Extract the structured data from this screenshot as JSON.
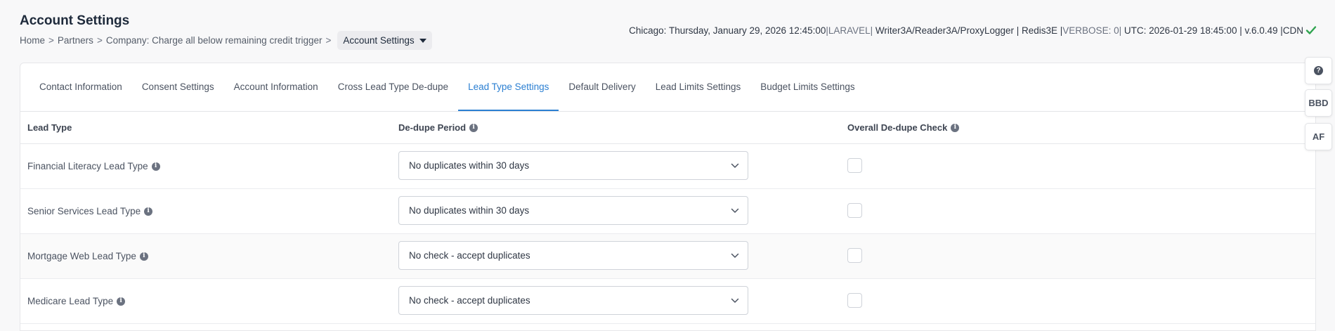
{
  "header": {
    "title": "Account Settings",
    "breadcrumb": [
      {
        "label": "Home"
      },
      {
        "label": "Partners"
      },
      {
        "label": "Company: Charge all below remaining credit trigger"
      }
    ],
    "breadcrumb_separator": ">",
    "current_page": "Account Settings"
  },
  "status": {
    "time": "Chicago: Thursday, January 29, 2026 12:45:00",
    "framework": "|LARAVEL|",
    "loggers": " Writer3A/Reader3A/ProxyLogger | Redis3E |",
    "verbose": "VERBOSE: 0|",
    "utc": " UTC: 2026-01-29 18:45:00 | v.6.0.49 |CDN",
    "cdn_ok_color": "#2fa44f"
  },
  "tabs": [
    {
      "label": "Contact Information",
      "active": false
    },
    {
      "label": "Consent Settings",
      "active": false
    },
    {
      "label": "Account Information",
      "active": false
    },
    {
      "label": "Cross Lead Type De-dupe",
      "active": false
    },
    {
      "label": "Lead Type Settings",
      "active": true
    },
    {
      "label": "Default Delivery",
      "active": false
    },
    {
      "label": "Lead Limits Settings",
      "active": false
    },
    {
      "label": "Budget Limits Settings",
      "active": false
    }
  ],
  "table": {
    "columns": [
      "Lead Type",
      "De-dupe Period",
      "Overall De-dupe Check"
    ],
    "rows": [
      {
        "lead_type": "Financial Literacy Lead Type",
        "dedupe_period": "No duplicates within 30 days",
        "overall_check": false
      },
      {
        "lead_type": "Senior Services Lead Type",
        "dedupe_period": "No duplicates within 30 days",
        "overall_check": false
      },
      {
        "lead_type": "Mortgage Web Lead Type",
        "dedupe_period": "No check - accept duplicates",
        "overall_check": false
      },
      {
        "lead_type": "Medicare Lead Type",
        "dedupe_period": "No check - accept duplicates",
        "overall_check": false
      }
    ]
  },
  "side_buttons": {
    "help_icon": "question-circle-icon",
    "bbd": "BBD",
    "af": "AF"
  },
  "colors": {
    "accent": "#2b7fd2",
    "title": "#1e2a3b"
  }
}
